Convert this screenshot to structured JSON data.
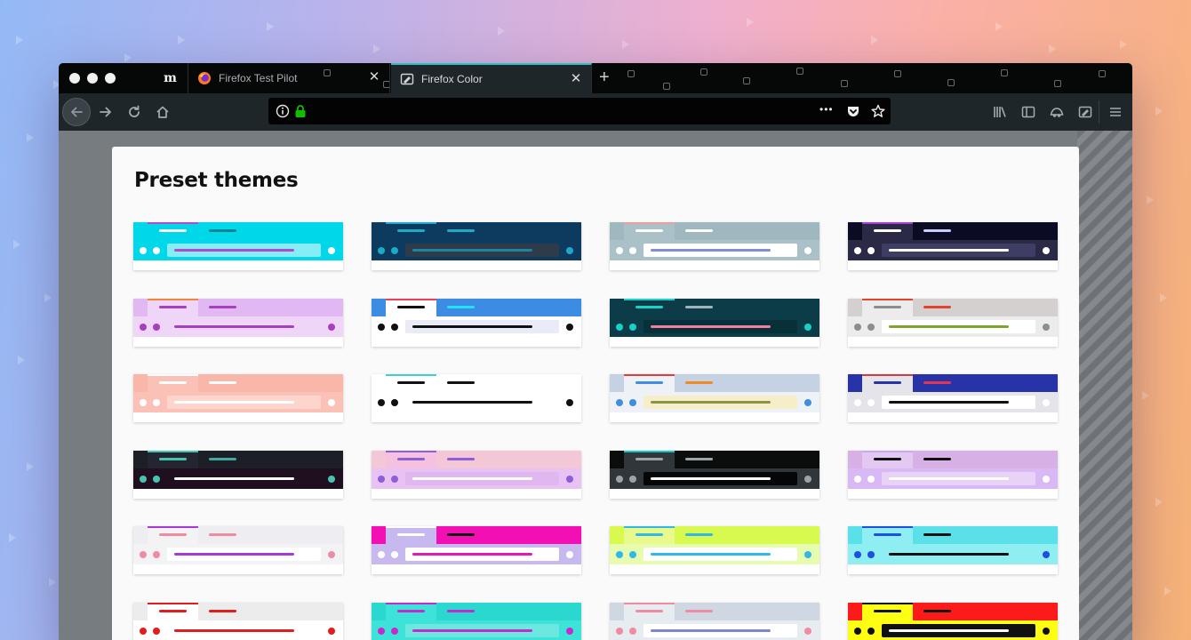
{
  "browser": {
    "pinned_tab_glyph": "m",
    "tabs": [
      {
        "title": "Firefox Test Pilot",
        "icon": "firefox-icon"
      },
      {
        "title": "Firefox Color",
        "icon": "firefox-color-icon"
      }
    ],
    "close_glyph": "✕",
    "new_tab_glyph": "+",
    "url_value": "",
    "page_actions_glyph": "•••"
  },
  "page": {
    "title": "Preset themes"
  },
  "themes": [
    {
      "frame": "#00d7e9",
      "tab": "#00d7e9",
      "accent": "#b04bd0",
      "tabtext": "#ffffff",
      "tab2text": "#0b8194",
      "toolbar": "#00d7e9",
      "url": "#86ecf5",
      "urltext": "#b04bd0",
      "dots": "#ffffff"
    },
    {
      "frame": "#0d3b60",
      "tab": "#0d3b60",
      "accent": "#1fa9c6",
      "tabtext": "#1fa9c6",
      "tab2text": "#1fa9c6",
      "toolbar": "#0d3b60",
      "url": "#2e3b48",
      "urltext": "#1b86a4",
      "dots": "#1fa9c6"
    },
    {
      "frame": "#9fb8bf",
      "tab": "#a9c1c7",
      "accent": "#e8a0a0",
      "tabtext": "#ffffff",
      "tab2text": "#ffffff",
      "toolbar": "#a9c1c7",
      "url": "#ffffff",
      "urltext": "#7f8fcf",
      "dots": "#ffffff"
    },
    {
      "frame": "#0b0b24",
      "tab": "#2a2946",
      "accent": "#a63bd6",
      "tabtext": "#ffffff",
      "tab2text": "#c9ccff",
      "toolbar": "#2a2946",
      "url": "#3e3d64",
      "urltext": "#ffffff",
      "dots": "#ffffff"
    },
    {
      "frame": "#e2b8f2",
      "tab": "#efd5f7",
      "accent": "#f0863c",
      "tabtext": "#a63fc0",
      "tab2text": "#a63fc0",
      "toolbar": "#efd5f7",
      "url": "#efd5f7",
      "urltext": "#a63fc0",
      "dots": "#a63fc0"
    },
    {
      "frame": "#3c8ce4",
      "tab": "#ffffff",
      "accent": "#ee3f5a",
      "tabtext": "#111111",
      "tab2text": "#23e2ff",
      "toolbar": "#ffffff",
      "url": "#e9ebf8",
      "urltext": "#111111",
      "dots": "#111111"
    },
    {
      "frame": "#0b3c47",
      "tab": "#0b3c47",
      "accent": "#18d1c7",
      "tabtext": "#18d1c7",
      "tab2text": "#9fb4ba",
      "toolbar": "#0b3c47",
      "url": "#083039",
      "urltext": "#f47ea0",
      "dots": "#18d1c7"
    },
    {
      "frame": "#d4d0d0",
      "tab": "#ececec",
      "accent": "#e0462c",
      "tabtext": "#8d8d8d",
      "tab2text": "#e0462c",
      "toolbar": "#ececec",
      "url": "#ffffff",
      "urltext": "#7ea32e",
      "dots": "#8d8d8d"
    },
    {
      "frame": "#f9b7aa",
      "tab": "#fcc1b6",
      "accent": "#ffffff",
      "tabtext": "#ffffff",
      "tab2text": "#ffffff",
      "toolbar": "#fcc1b6",
      "url": "#fdd5cc",
      "urltext": "#ffffff",
      "dots": "#ffffff"
    },
    {
      "frame": "#ffffff",
      "tab": "#ffffff",
      "accent": "#3ad1cf",
      "tabtext": "#111111",
      "tab2text": "#111111",
      "toolbar": "#ffffff",
      "url": "#ffffff",
      "urltext": "#111111",
      "dots": "#111111"
    },
    {
      "frame": "#c5d2e4",
      "tab": "#eef1f5",
      "accent": "#e23b3b",
      "tabtext": "#3f8ee0",
      "tab2text": "#f08a1f",
      "toolbar": "#eef1f5",
      "url": "#f6eec9",
      "urltext": "#8a9346",
      "dots": "#3f8ee0"
    },
    {
      "frame": "#2933a8",
      "tab": "#e4e4ea",
      "accent": "#d23b46",
      "tabtext": "#2933a8",
      "tab2text": "#e33650",
      "toolbar": "#e4e4ea",
      "url": "#ffffff",
      "urltext": "#111111",
      "dots": "#ffffff"
    },
    {
      "frame": "#1d1f26",
      "tab": "#232630",
      "accent": "#47c4b1",
      "tabtext": "#47c4b1",
      "tab2text": "#47a6a0",
      "toolbar": "#20101f",
      "url": "#20101f",
      "urltext": "#ffffff",
      "dots": "#47c4b1"
    },
    {
      "frame": "#f4c7d6",
      "tab": "#f6c0e0",
      "accent": "#8c5fd7",
      "tabtext": "#8c5fd7",
      "tab2text": "#8c5fd7",
      "toolbar": "#e9c2f4",
      "url": "#e0b7ef",
      "urltext": "#ffffff",
      "dots": "#8c5fd7"
    },
    {
      "frame": "#0b0c0c",
      "tab": "#30363a",
      "accent": "#16c7c4",
      "tabtext": "#9aa3a8",
      "tab2text": "#9aa3a8",
      "toolbar": "#30363a",
      "url": "#060606",
      "urltext": "#ffffff",
      "dots": "#9aa3a8"
    },
    {
      "frame": "#d7b1e6",
      "tab": "#e3c8f2",
      "accent": "#c9aaf0",
      "tabtext": "#111111",
      "tab2text": "#111111",
      "toolbar": "#d9b8f6",
      "url": "#e8d3f7",
      "urltext": "#ffffff",
      "dots": "#ffffff"
    },
    {
      "frame": "#ededf2",
      "tab": "#f3f3f6",
      "accent": "#a73ad6",
      "tabtext": "#f08ca2",
      "tab2text": "#f08ca2",
      "toolbar": "#f3f3f6",
      "url": "#ffffff",
      "urltext": "#a73ad6",
      "dots": "#f08ca2"
    },
    {
      "frame": "#f20fb3",
      "tab": "#c7b8ef",
      "accent": "#ffffff",
      "tabtext": "#ffffff",
      "tab2text": "#111111",
      "toolbar": "#c7b8ef",
      "url": "#ffffff",
      "urltext": "#e41ab5",
      "dots": "#ffffff"
    },
    {
      "frame": "#d8f94d",
      "tab": "#e8fa8c",
      "accent": "#30b8e8",
      "tabtext": "#30b8e8",
      "tab2text": "#30b8e8",
      "toolbar": "#e8fcb0",
      "url": "#ffffff",
      "urltext": "#30b8e8",
      "dots": "#30b8e8"
    },
    {
      "frame": "#5ae0e8",
      "tab": "#8eeef2",
      "accent": "#1d4fe0",
      "tabtext": "#1d4fe0",
      "tab2text": "#111111",
      "toolbar": "#8eeef2",
      "url": "#8eeef2",
      "urltext": "#111111",
      "dots": "#1d4fe0"
    },
    {
      "frame": "#ececec",
      "tab": "#ffffff",
      "accent": "#e21d1d",
      "tabtext": "#e21d1d",
      "tab2text": "#e21d1d",
      "toolbar": "#ffffff",
      "url": "#ffffff",
      "urltext": "#e21d1d",
      "dots": "#e21d1d"
    },
    {
      "frame": "#2ad8d0",
      "tab": "#3de2d8",
      "accent": "#c52bcb",
      "tabtext": "#c52bcb",
      "tab2text": "#c52bcb",
      "toolbar": "#3de2d8",
      "url": "#6de8e0",
      "urltext": "#c52bcb",
      "dots": "#c52bcb"
    },
    {
      "frame": "#cfd7e3",
      "tab": "#e7ecf1",
      "accent": "#f08ca2",
      "tabtext": "#f08ca2",
      "tab2text": "#f08ca2",
      "toolbar": "#e7ecf1",
      "url": "#ffffff",
      "urltext": "#7f86d0",
      "dots": "#f08ca2"
    },
    {
      "frame": "#fb1b1b",
      "tab": "#fefe12",
      "accent": "#111111",
      "tabtext": "#111111",
      "tab2text": "#111111",
      "toolbar": "#fefe12",
      "url": "#111111",
      "urltext": "#ffffff",
      "dots": "#111111"
    }
  ]
}
